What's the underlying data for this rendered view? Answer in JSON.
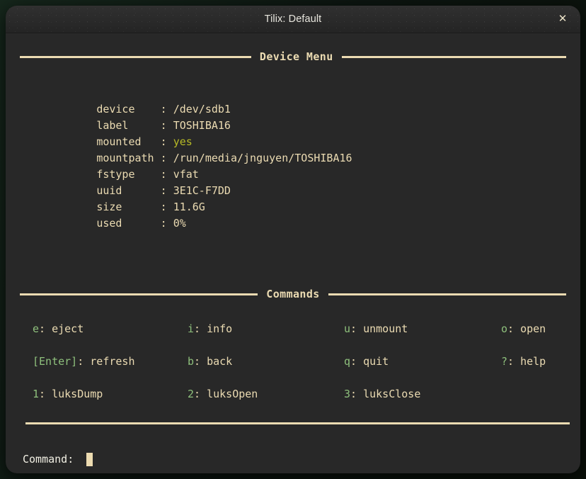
{
  "window": {
    "title": "Tilix: Default",
    "close_icon": "close-icon",
    "close_glyph": "✕"
  },
  "theme": {
    "background": "#282828",
    "foreground": "#ebdbb2",
    "accent_key": "#8ec07c",
    "accent_value": "#b8bb26",
    "titlebar": "#2b2b2b"
  },
  "device_menu": {
    "title": "Device Menu",
    "rows": [
      {
        "key": "device",
        "colon": ":",
        "value": "/dev/sdb1",
        "highlight": false
      },
      {
        "key": "label",
        "colon": ":",
        "value": "TOSHIBA16",
        "highlight": false
      },
      {
        "key": "mounted",
        "colon": ":",
        "value": "yes",
        "highlight": true
      },
      {
        "key": "mountpath",
        "colon": ":",
        "value": "/run/media/jnguyen/TOSHIBA16",
        "highlight": false
      },
      {
        "key": "fstype",
        "colon": ":",
        "value": "vfat",
        "highlight": false
      },
      {
        "key": "uuid",
        "colon": ":",
        "value": "3E1C-F7DD",
        "highlight": false
      },
      {
        "key": "size",
        "colon": ":",
        "value": "11.6G",
        "highlight": false
      },
      {
        "key": "used",
        "colon": ":",
        "value": "0%",
        "highlight": false
      }
    ]
  },
  "commands": {
    "title": "Commands",
    "rows": [
      [
        {
          "key": "e",
          "sep": ": ",
          "label": "eject"
        },
        {
          "key": "i",
          "sep": ": ",
          "label": "info"
        },
        {
          "key": "u",
          "sep": ": ",
          "label": "unmount"
        },
        {
          "key": "o",
          "sep": ": ",
          "label": "open"
        }
      ],
      [
        {
          "key": "[Enter]",
          "sep": ": ",
          "label": "refresh"
        },
        {
          "key": "b",
          "sep": ": ",
          "label": "back"
        },
        {
          "key": "q",
          "sep": ": ",
          "label": "quit"
        },
        {
          "key": "?",
          "sep": ": ",
          "label": "help"
        }
      ],
      [
        {
          "key": "1",
          "sep": ": ",
          "label": "luksDump"
        },
        {
          "key": "2",
          "sep": ": ",
          "label": "luksOpen"
        },
        {
          "key": "3",
          "sep": ": ",
          "label": "luksClose"
        }
      ]
    ]
  },
  "prompt": {
    "label": "Command: ",
    "value": "",
    "placeholder": ""
  }
}
